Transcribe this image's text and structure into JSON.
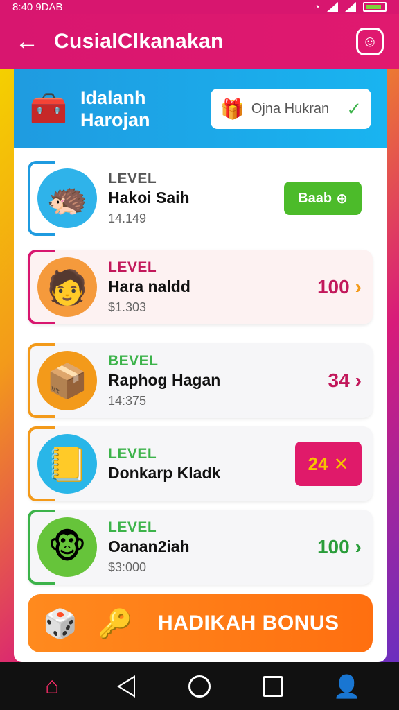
{
  "status_bar": {
    "time": "8:40 9DAB",
    "icons": [
      "wifi-icon",
      "signal-icon",
      "signal-icon",
      "battery-icon"
    ]
  },
  "app_bar": {
    "title": "CusialClkanakan",
    "back_icon": "←",
    "mascot_icon": "☺"
  },
  "panel_header": {
    "title_line1": "Idalanh",
    "title_line2": "Harojan",
    "chest_icon": "🧰",
    "select": {
      "value": "Ojna Hukran",
      "gift_icon": "🎁",
      "check_icon": "✓"
    }
  },
  "levels": [
    {
      "label": "LEVEL",
      "name": "Hakoi Saih",
      "sub": "14.149",
      "action": "Baab",
      "action_icon": "⊕",
      "avatar_icon": "🦔",
      "accent": "#1f9be0",
      "label_color": "#555555"
    },
    {
      "label": "LEVEL",
      "name": "Hara naldd",
      "sub": "$1.303",
      "value": "100",
      "chev": "›",
      "avatar_icon": "🧑",
      "accent": "#d8166f",
      "label_color": "#c2185b",
      "value_color": "#c2185b"
    },
    {
      "label": "BEVEL",
      "name": "Raphog Hagan",
      "sub": "14:375",
      "value": "34",
      "chev": "›",
      "avatar_icon": "📦",
      "accent": "#f39a1a",
      "label_color": "#3cb34a",
      "value_color": "#c2185b"
    },
    {
      "label": "LEVEL",
      "name": "Donkarp Kladk",
      "sub": "",
      "value": "24",
      "action_icon": "✕",
      "avatar_icon": "📒",
      "accent": "#f39a1a",
      "label_color": "#3cb34a"
    },
    {
      "label": "LEVEL",
      "name": "Oanan2iah",
      "sub": "$3:000",
      "value": "100",
      "chev": "›",
      "avatar_icon": "🐵",
      "accent": "#3cb34a",
      "label_color": "#3cb34a",
      "value_color": "#2a9d3a"
    }
  ],
  "bonus": {
    "label": "HADIKAH BONUS",
    "icons": [
      "🎲",
      "🔑"
    ]
  },
  "nav": {
    "home_icon": "⌂",
    "user_icon": "👤"
  }
}
